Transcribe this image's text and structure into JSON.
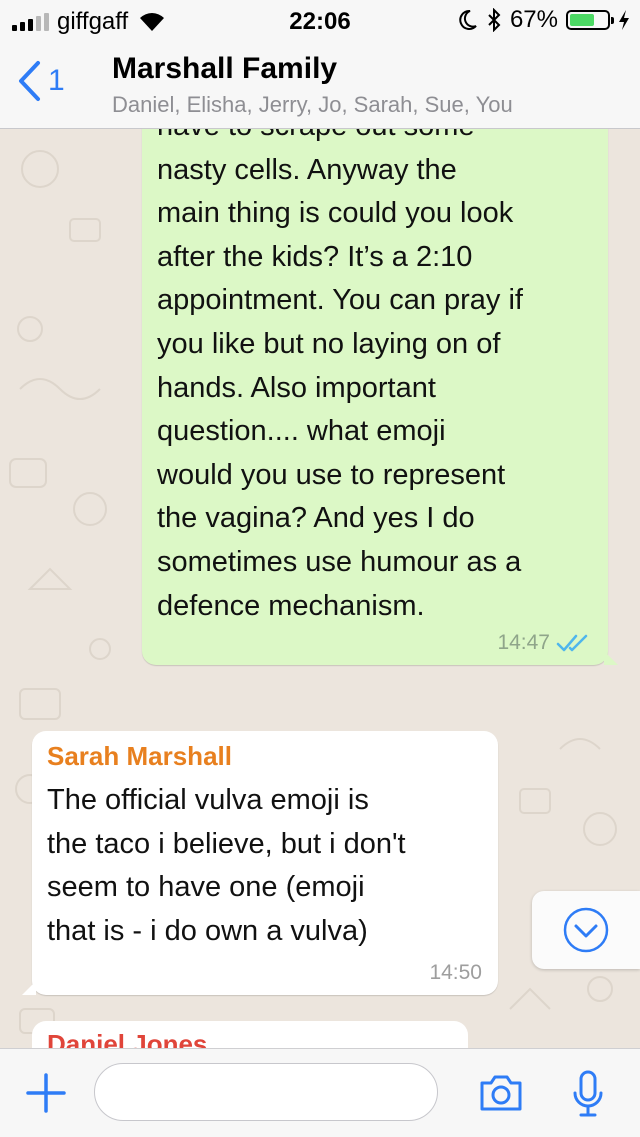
{
  "status_bar": {
    "carrier": "giffgaff",
    "time": "22:06",
    "battery_percent": "67%",
    "battery_level": 0.67,
    "icons": [
      "signal-icon",
      "wifi-icon",
      "moon-icon",
      "bluetooth-icon",
      "battery-icon",
      "charging-icon"
    ]
  },
  "header": {
    "back_count": "1",
    "title": "Marshall Family",
    "participants": "Daniel, Elisha, Jerry, Jo, Sarah, Sue, You"
  },
  "messages": [
    {
      "direction": "outgoing",
      "text": "have to scrape out some\nnasty cells. Anyway the\nmain thing is could you look\nafter the kids? It’s a 2:10\nappointment. You can pray if\nyou like but no laying on of\nhands. Also important\nquestion.... what emoji\nwould you use to represent\nthe vagina? And yes I do\nsometimes use humour as a\ndefence mechanism.",
      "time": "14:47",
      "status": "read"
    },
    {
      "direction": "incoming",
      "sender": "Sarah Marshall",
      "sender_color": "#e8801f",
      "text": "The official vulva emoji is\nthe taco i believe, but i don't\nseem to have one (emoji\nthat is - i do own a vulva)",
      "time": "14:50"
    },
    {
      "direction": "incoming",
      "sender": "Daniel Jones",
      "sender_color": "#e0453a"
    }
  ],
  "colors": {
    "accent": "#2e7cf6",
    "outgoing_bubble": "#dcf8c6",
    "incoming_bubble": "#ffffff",
    "read_ticks": "#4fb6ec"
  },
  "input_bar": {
    "placeholder": "",
    "icons": [
      "plus-icon",
      "camera-icon",
      "microphone-icon"
    ]
  }
}
